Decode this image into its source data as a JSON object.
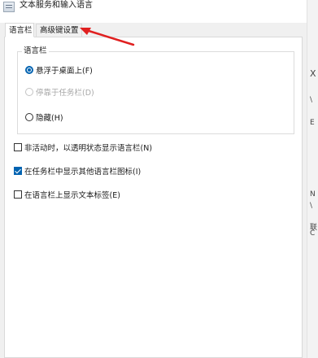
{
  "window": {
    "title": "文本服务和输入语言"
  },
  "tabs": [
    {
      "label": "语言栏",
      "active": true
    },
    {
      "label": "高级键设置",
      "active": false
    }
  ],
  "language_bar_group": {
    "legend": "语言栏",
    "options": [
      {
        "label": "悬浮于桌面上(F)",
        "checked": true,
        "enabled": true
      },
      {
        "label": "停靠于任务栏(D)",
        "checked": false,
        "enabled": false
      },
      {
        "label": "隐藏(H)",
        "checked": false,
        "enabled": true
      }
    ]
  },
  "checkboxes": [
    {
      "label": "非活动时，以透明状态显示语言栏(N)",
      "checked": false
    },
    {
      "label": "在任务栏中显示其他语言栏图标(I)",
      "checked": true
    },
    {
      "label": "在语言栏上显示文本标签(E)",
      "checked": false
    }
  ],
  "background_window": {
    "glyphs": [
      "X",
      "\\",
      "E",
      "N",
      "\\",
      "联",
      "C"
    ]
  },
  "colors": {
    "accent": "#0063b1",
    "annotation_arrow": "#e02020",
    "dialog_background": "#f0f0f0"
  }
}
